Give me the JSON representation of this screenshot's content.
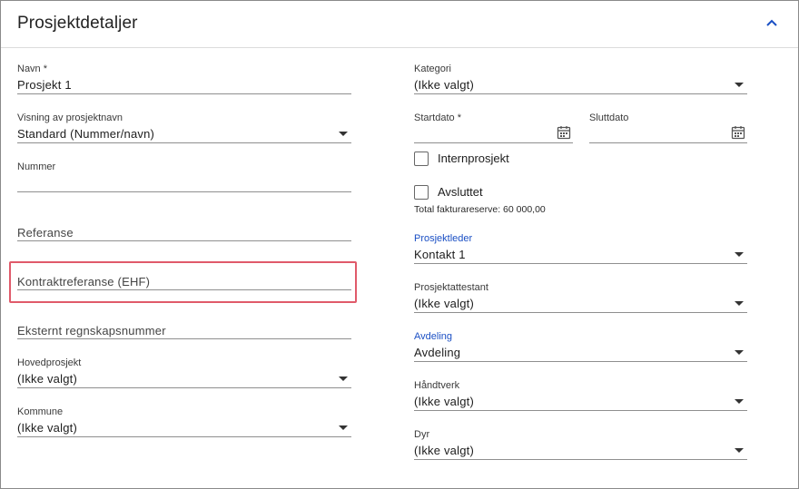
{
  "header": {
    "title": "Prosjektdetaljer",
    "collapse_icon": "chevron-up-icon",
    "accent": "#1a4fc4"
  },
  "left": {
    "navn": {
      "label": "Navn *",
      "value": "Prosjekt 1"
    },
    "visning": {
      "label": "Visning av prosjektnavn",
      "value": "Standard (Nummer/navn)"
    },
    "nummer": {
      "label": "Nummer",
      "value": ""
    },
    "referanse": {
      "placeholder": "Referanse"
    },
    "kontraktreferanse": {
      "placeholder": "Kontraktreferanse (EHF)",
      "highlight_color": "#e05a6a"
    },
    "eksternt": {
      "placeholder": "Eksternt regnskapsnummer"
    },
    "hovedprosjekt": {
      "label": "Hovedprosjekt",
      "value": "(Ikke valgt)"
    },
    "kommune": {
      "label": "Kommune",
      "value": "(Ikke valgt)"
    }
  },
  "right": {
    "kategori": {
      "label": "Kategori",
      "value": "(Ikke valgt)"
    },
    "startdato": {
      "label": "Startdato *",
      "value": ""
    },
    "sluttdato": {
      "label": "Sluttdato",
      "value": ""
    },
    "internprosjekt": {
      "label": "Internprosjekt",
      "checked": false
    },
    "avsluttet": {
      "label": "Avsluttet",
      "checked": false
    },
    "fakturareserve": "Total fakturareserve: 60 000,00",
    "prosjektleder": {
      "label": "Prosjektleder",
      "value": "Kontakt 1"
    },
    "prosjektattestant": {
      "label": "Prosjektattestant",
      "value": "(Ikke valgt)"
    },
    "avdeling": {
      "label": "Avdeling",
      "value": "Avdeling"
    },
    "handtverk": {
      "label": "Håndtverk",
      "value": "(Ikke valgt)"
    },
    "dyr": {
      "label": "Dyr",
      "value": "(Ikke valgt)"
    }
  }
}
